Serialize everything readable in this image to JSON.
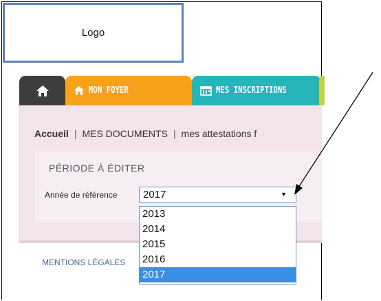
{
  "logo": {
    "text": "Logo"
  },
  "tabs": [
    {
      "id": "home",
      "icon": "home-icon",
      "color": "#3d3d3d"
    },
    {
      "id": "foyer",
      "label": "MON FOYER",
      "icon": "house-icon",
      "color": "#f7a21a"
    },
    {
      "id": "inscriptions",
      "label": "MES INSCRIPTIONS",
      "icon": "calendar-icon",
      "color": "#26b5b9"
    }
  ],
  "breadcrumb": {
    "home": "Accueil",
    "separator": "|",
    "documents": "MES DOCUMENTS",
    "current": "mes attestations f"
  },
  "period": {
    "title": "PÉRIODE À ÉDITER",
    "year_label": "Année de référence",
    "selected": "2017",
    "options": [
      "2013",
      "2014",
      "2015",
      "2016",
      "2017"
    ]
  },
  "footer": {
    "legal": "MENTIONS LÉGALES"
  },
  "colors": {
    "panel": "#f3e3ea",
    "select_border": "#6f8fc4",
    "selected_option": "#3a8ee6",
    "logo_border": "#5a80c0"
  }
}
